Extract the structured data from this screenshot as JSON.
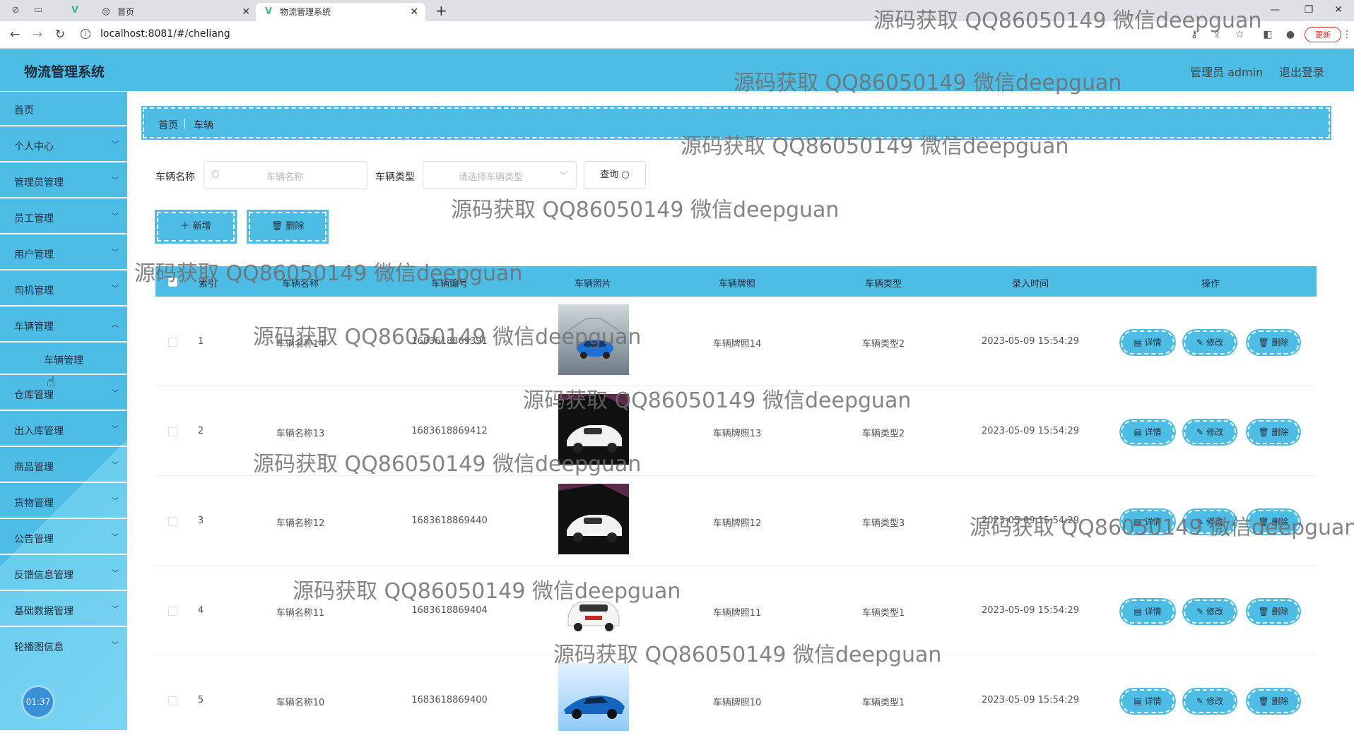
{
  "browser": {
    "tabs": [
      {
        "label": "首页",
        "icon": "globe-icon"
      },
      {
        "label": "物流管理系统",
        "icon": "vue-logo-icon"
      }
    ],
    "url": "localhost:8081/#/cheliang",
    "update_label": "更新"
  },
  "header": {
    "title": "物流管理系统",
    "user": "管理员 admin",
    "logout": "退出登录"
  },
  "sidebar": {
    "items": [
      {
        "label": "首页",
        "has_arrow": false
      },
      {
        "label": "个人中心",
        "has_arrow": true
      },
      {
        "label": "管理员管理",
        "has_arrow": true
      },
      {
        "label": "员工管理",
        "has_arrow": true
      },
      {
        "label": "用户管理",
        "has_arrow": true
      },
      {
        "label": "司机管理",
        "has_arrow": true
      },
      {
        "label": "车辆管理",
        "has_arrow": true,
        "expanded": true
      },
      {
        "label": "仓库管理",
        "has_arrow": true
      },
      {
        "label": "出入库管理",
        "has_arrow": true
      },
      {
        "label": "商品管理",
        "has_arrow": true
      },
      {
        "label": "货物管理",
        "has_arrow": true
      },
      {
        "label": "公告管理",
        "has_arrow": true
      },
      {
        "label": "反馈信息管理",
        "has_arrow": true
      },
      {
        "label": "基础数据管理",
        "has_arrow": true
      },
      {
        "label": "轮播图信息",
        "has_arrow": true
      }
    ],
    "submenu": {
      "label": "车辆管理"
    },
    "clock": "01:37"
  },
  "breadcrumb": {
    "home": "首页",
    "separator": "|",
    "current": "车辆"
  },
  "search": {
    "name_label": "车辆名称",
    "name_placeholder": "车辆名称",
    "type_label": "车辆类型",
    "type_placeholder": "请选择车辆类型",
    "query_label": "查询"
  },
  "actions": {
    "add_label": "新增",
    "delete_label": "删除"
  },
  "table": {
    "columns": [
      "索引",
      "车辆名称",
      "车辆编号",
      "车辆照片",
      "车辆牌照",
      "车辆类型",
      "录入时间",
      "操作"
    ],
    "rows": [
      {
        "index": "1",
        "name": "车辆名称14",
        "code": "1683618869391",
        "plate": "车辆牌照14",
        "type": "车辆类型2",
        "time": "2023-05-09 15:54:29",
        "photo": "blue-car"
      },
      {
        "index": "2",
        "name": "车辆名称13",
        "code": "1683618869412",
        "plate": "车辆牌照13",
        "type": "车辆类型2",
        "time": "2023-05-09 15:54:29",
        "photo": "white-car"
      },
      {
        "index": "3",
        "name": "车辆名称12",
        "code": "1683618869440",
        "plate": "车辆牌照12",
        "type": "车辆类型3",
        "time": "2023-05-09 15:54:29",
        "photo": "white-car"
      },
      {
        "index": "4",
        "name": "车辆名称11",
        "code": "1683618869404",
        "plate": "车辆牌照11",
        "type": "车辆类型1",
        "time": "2023-05-09 15:54:29",
        "photo": "white-suv"
      },
      {
        "index": "5",
        "name": "车辆名称10",
        "code": "1683618869400",
        "plate": "车辆牌照10",
        "type": "车辆类型1",
        "time": "2023-05-09 15:54:29",
        "photo": "blue-sportscar"
      }
    ],
    "row_actions": {
      "detail": "详情",
      "edit": "修改",
      "delete": "删除"
    }
  },
  "watermark": "源码获取 QQ86050149 微信deepguan",
  "colors": {
    "primary": "#4dbde6",
    "text_dark": "#1f2d3d"
  }
}
